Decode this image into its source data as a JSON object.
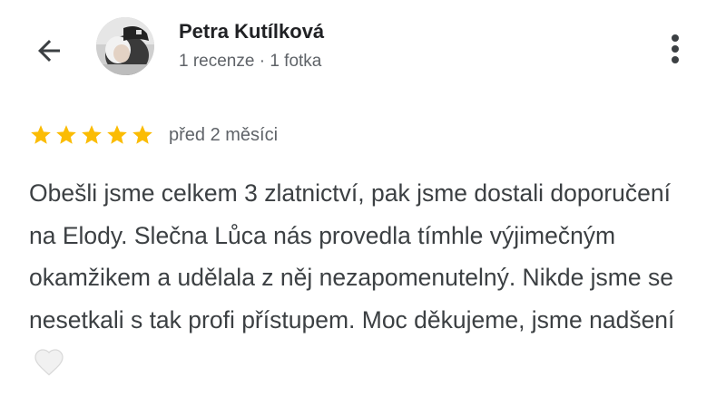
{
  "author": {
    "name": "Petra Kutílková",
    "meta": "1 recenze · 1 fotka"
  },
  "icons": {
    "back": "arrow-back-icon",
    "more": "more-vertical-icon",
    "star": "star-icon",
    "heart": "white-heart-icon"
  },
  "review": {
    "rating": 5,
    "max_rating": 5,
    "date": "před 2 měsíci",
    "text": "Obešli jsme celkem 3 zlatnictví, pak jsme dostali doporučení na Elody. Slečna Lůca nás provedla tímhle výjimečným okamžikem a udělala z něj nezapomenutelný. Nikde jsme se nesetkali s tak profi přístupem. Moc děkujeme, jsme nadšení"
  },
  "colors": {
    "star": "#fbbc04",
    "name": "#202124",
    "secondary": "#5f6368",
    "body": "#3c4043"
  }
}
